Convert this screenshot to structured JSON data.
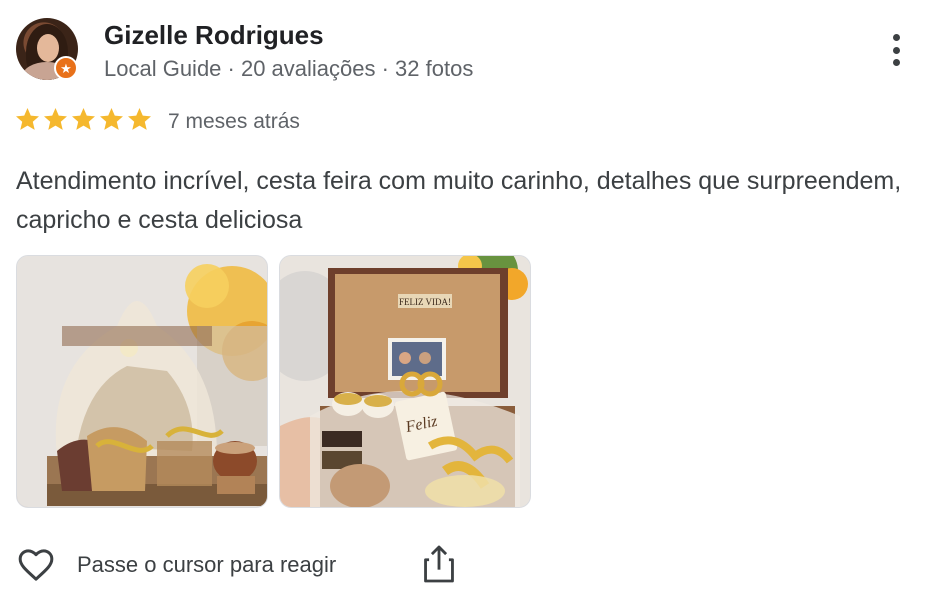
{
  "reviewer": {
    "name": "Gizelle Rodrigues",
    "meta": "Local Guide · 20 avaliações · 32 fotos",
    "badge_icon": "local-guide-star-icon",
    "badge_color": "#e8711a"
  },
  "rating": {
    "stars": 5,
    "max": 5,
    "star_color": "#f5b82e"
  },
  "time_ago": "7 meses atrás",
  "review_text": "Atendimento incrível, cesta feira com muito carinho, detalhes que surpreendem, capricho e cesta deliciosa",
  "photos": [
    {
      "alt": "gift basket photo",
      "caption": ""
    },
    {
      "alt": "gift basket with photo frame",
      "frame_text": "FELIZ VIDA!",
      "tag_text": "Feliz"
    }
  ],
  "actions": {
    "react_label": "Passe o cursor para reagir",
    "react_icon": "heart-icon",
    "share_icon": "share-icon",
    "more_icon": "more-vertical-icon"
  }
}
